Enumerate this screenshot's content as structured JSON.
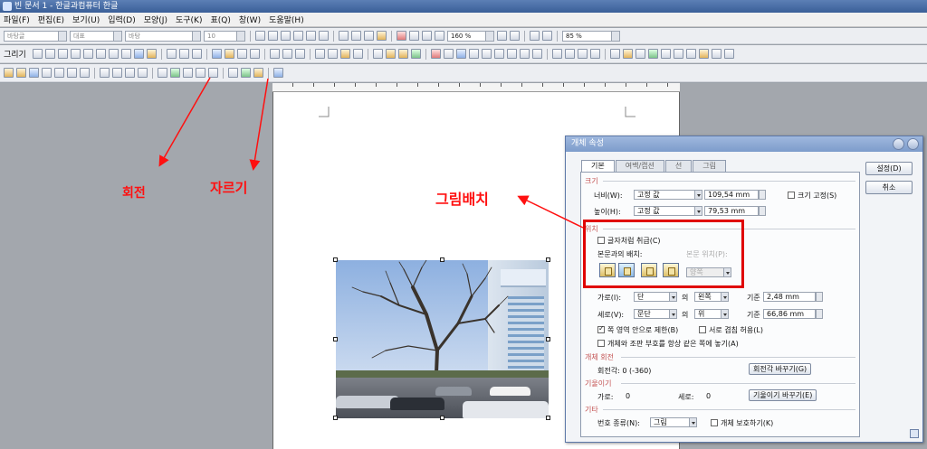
{
  "window": {
    "title": "빈 문서 1 - 한글과컴퓨터 한글"
  },
  "menu": [
    "파일(F)",
    "편집(E)",
    "보기(U)",
    "입력(D)",
    "모양(J)",
    "도구(K)",
    "표(Q)",
    "창(W)",
    "도움말(H)"
  ],
  "toolbar": {
    "style_combo": "바탕글",
    "style2_combo": "대표",
    "font_combo": "바탕",
    "size_combo": "10",
    "spacing_combo": "160 %",
    "zoom_combo": "85 %",
    "draw_label": "그리기"
  },
  "annotations": {
    "rotate": "회전",
    "crop": "자르기",
    "placement": "그림배치"
  },
  "dialog": {
    "title": "개체 속성",
    "tabs": [
      "기본",
      "여백/캡션",
      "선",
      "그림"
    ],
    "buttons": {
      "ok": "설정(D)",
      "cancel": "취소"
    },
    "size": {
      "section": "크기",
      "width_label": "너비(W):",
      "width_mode": "고정 값",
      "width_value": "109,54 mm",
      "height_label": "높이(H):",
      "height_mode": "고정 값",
      "height_value": "79,53 mm",
      "lock_label": "크기 고정(S)"
    },
    "position": {
      "section": "위치",
      "treat_as_char": "글자처럼 취급(C)",
      "wrap_label": "본문과의 배치:",
      "text_position_label": "본문 위치(P):",
      "text_position_value": "양쪽",
      "horiz_label": "가로(I):",
      "horiz_ref": "단",
      "horiz_of": "의",
      "horiz_align": "왼쪽",
      "horiz_base_label": "기준",
      "horiz_value": "2,48 mm",
      "vert_label": "세로(V):",
      "vert_ref": "문단",
      "vert_of": "의",
      "vert_align": "위",
      "vert_base_label": "기준",
      "vert_value": "66,86 mm",
      "limit_label": "쪽 영역 안으로 제한(B)",
      "overlap_label": "서로 겹침 허용(L)",
      "anchor_label": "개체와 조판 부호를 항상 같은 쪽에 놓기(A)"
    },
    "rotation": {
      "section": "개체 회전",
      "angle_label": "회전각: 0 (-360)",
      "button": "회전각 바꾸기(G)"
    },
    "skew": {
      "section": "기울이기",
      "h_label": "가로:",
      "h_value": "0",
      "v_label": "세로:",
      "v_value": "0",
      "button": "기울이기 바꾸기(E)"
    },
    "other": {
      "section": "기타",
      "number_label": "번호 종류(N):",
      "number_value": "그림",
      "protect_label": "개체 보호하기(K)"
    }
  }
}
